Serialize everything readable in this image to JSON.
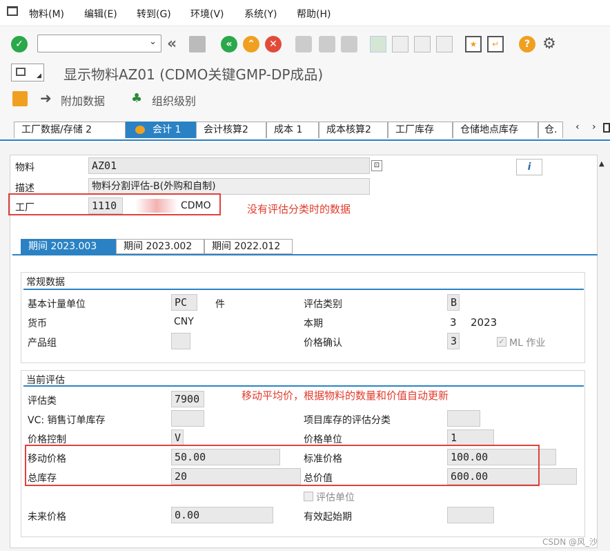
{
  "menu": [
    "物料(M)",
    "编辑(E)",
    "转到(G)",
    "环境(V)",
    "系统(Y)",
    "帮助(H)"
  ],
  "title": "显示物料AZ01 (CDMO关键GMP-DP成品)",
  "app_toolbar": {
    "additional_data": "附加数据",
    "org_levels": "组织级别"
  },
  "tabs": [
    "工厂数据/存储 2",
    "会计 1",
    "会计核算2",
    "成本 1",
    "成本核算2",
    "工厂库存",
    "仓储地点库存",
    "仓."
  ],
  "header": {
    "material_label": "物料",
    "material_value": "AZ01",
    "desc_label": "描述",
    "desc_value": "物料分割评估-B(外购和自制)",
    "plant_label": "工厂",
    "plant_value": "1110",
    "plant_name": "CDMO"
  },
  "annotation1": "没有评估分类时的数据",
  "period_tabs": [
    "期间 2023.003",
    "期间 2023.002",
    "期间 2022.012"
  ],
  "general": {
    "section": "常规数据",
    "base_uom_label": "基本计量单位",
    "base_uom_value": "PC",
    "base_uom_text": "件",
    "val_cat_label": "评估类别",
    "val_cat_value": "B",
    "currency_label": "货币",
    "currency_value": "CNY",
    "period_label": "本期",
    "period_value": "3",
    "year_value": "2023",
    "prod_group_label": "产品组",
    "price_det_label": "价格确认",
    "price_det_value": "3",
    "ml_label": "ML 作业"
  },
  "valuation": {
    "section": "当前评估",
    "annotation": "移动平均价，根据物料的数量和价值自动更新",
    "val_class_label": "评估类",
    "val_class_value": "7900",
    "vc_label": "VC: 销售订单库存",
    "proj_label": "项目库存的评估分类",
    "price_ctrl_label": "价格控制",
    "price_ctrl_value": "V",
    "price_unit_label": "价格单位",
    "price_unit_value": "1",
    "map_label": "移动价格",
    "map_value": "50.00",
    "std_label": "标准价格",
    "std_value": "100.00",
    "total_stock_label": "总库存",
    "total_stock_value": "20",
    "total_value_label": "总价值",
    "total_value_value": "600.00",
    "val_unit_label": "评估单位",
    "future_label": "未来价格",
    "future_value": "0.00",
    "valid_from_label": "有效起始期"
  },
  "watermark": "CSDN @风_沙"
}
